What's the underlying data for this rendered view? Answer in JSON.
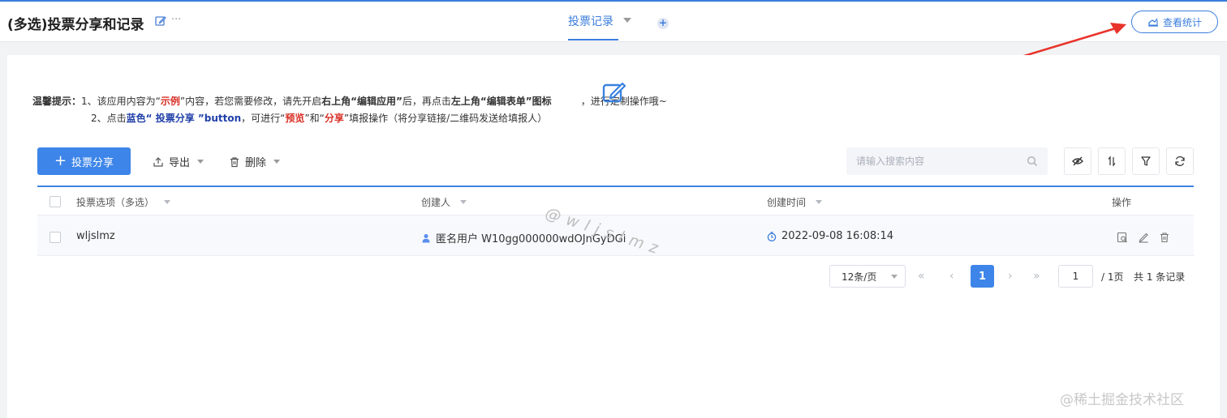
{
  "header": {
    "app_title": "(多选)投票分享和记录",
    "more_label": "···",
    "active_tab": "投票记录",
    "add_tab_symbol": "+",
    "stats_button": "查看统计"
  },
  "tip": {
    "label": "温馨提示：",
    "line1": {
      "p1": "1、该应用内容为“",
      "sample": "示例",
      "p2": "”内容，若您需要修改，请先开启",
      "bold1": "右上角“编辑应用”",
      "p3": "后，再点击",
      "bold2": "左上角“编辑表单”图标",
      "p4": "，进行定制操作哦~"
    },
    "line2": {
      "p1": "2、点击",
      "blue": "蓝色“ 投票分享 ”button",
      "p2": "，可进行“",
      "preview": "预览",
      "p3": "”和“",
      "share": "分享",
      "p4": "”填报操作（将分享链接/二维码发送给填报人）"
    }
  },
  "toolbar": {
    "share_plus": "+",
    "share_button": "投票分享",
    "export_button": "导出",
    "delete_button": "删除",
    "search_placeholder": "请输入搜索内容"
  },
  "table": {
    "columns": {
      "option": "投票选项（多选）",
      "creator": "创建人",
      "created_at": "创建时间",
      "actions": "操作"
    },
    "rows": [
      {
        "option": "wljslmz",
        "creator": "匿名用户 W10gg000000wdOJnGyDGi",
        "created_at": "2022-09-08 16:08:14"
      }
    ]
  },
  "pagination": {
    "page_size": "12条/页",
    "current_page": "1",
    "jump_value": "1",
    "total_pages": "/ 1页",
    "total_records": "共 1 条记录",
    "first_symbol": "«",
    "prev_symbol": "‹",
    "next_symbol": "›",
    "last_symbol": "»"
  },
  "watermarks": {
    "diagonal": "@wljslmz",
    "corner": "@稀土掘金技术社区"
  },
  "colors": {
    "primary": "#3d85e8",
    "tab_active": "#3b7ddd",
    "sample_red": "#d93026",
    "tip_blue": "#1f3fa8",
    "arrow_red": "#e8332a"
  }
}
